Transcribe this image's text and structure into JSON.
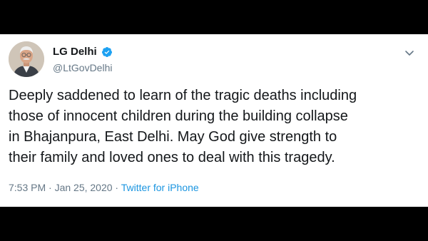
{
  "tweet": {
    "author": {
      "display_name": "LG Delhi",
      "handle": "@LtGovDelhi",
      "verified": true
    },
    "text_lines": [
      "Deeply saddened to learn of the tragic deaths including",
      "those of innocent children during the building collapse",
      "in Bhajanpura, East Delhi. May God give strength to",
      "their family and loved ones to deal with this tragedy."
    ],
    "timestamp": "7:53 PM · Jan 25, 2020",
    "separator": " · ",
    "source": "Twitter for iPhone"
  },
  "icons": {
    "verified": "verified-badge-icon",
    "menu": "chevron-down-icon"
  },
  "colors": {
    "background_frame": "#000000",
    "card": "#ffffff",
    "text": "#14171a",
    "secondary": "#657786",
    "link": "#1b95e0",
    "verified": "#1da1f2"
  }
}
